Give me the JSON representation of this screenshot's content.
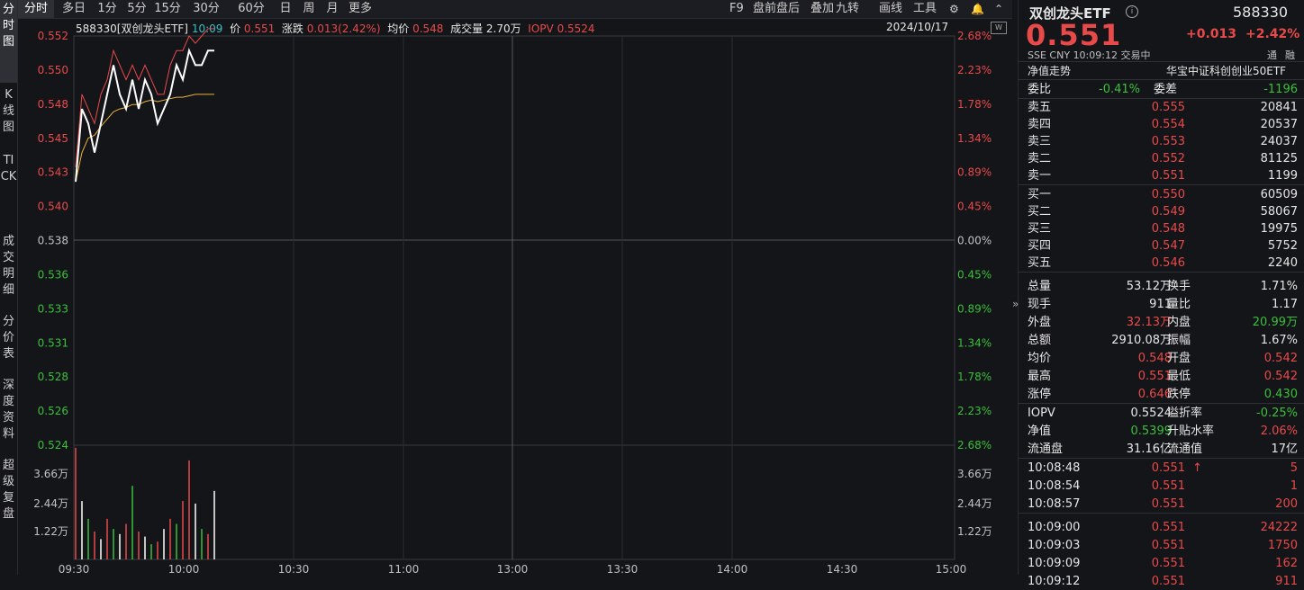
{
  "left_tabs": [
    "分时图",
    "K线图",
    "TICK",
    "成交明细",
    "分价表",
    "深度资料",
    "超级复盘"
  ],
  "toolbar": {
    "periods": [
      "分时",
      "多日",
      "1分",
      "5分",
      "15分",
      "30分",
      "60分",
      "日",
      "周",
      "月",
      "更多"
    ],
    "right": [
      "F9",
      "盘前盘后",
      "叠加",
      "九转",
      "画线",
      "工具"
    ],
    "gear_icon": "gear-icon",
    "bell_icon": "bell-icon",
    "up_icon": "chevron-up-icon"
  },
  "info": {
    "code_name": "588330[双创龙头ETF]",
    "time": "10:09",
    "price_label": "价",
    "price": "0.551",
    "change_label": "涨跌",
    "change": "0.013(2.42%)",
    "avg_label": "均价",
    "avg": "0.548",
    "vol_label": "成交量",
    "vol": "2.70万",
    "iopv_label": "IOPV",
    "iopv": "0.5524",
    "date": "2024/10/17"
  },
  "chart_data": {
    "type": "line",
    "price_axis": [
      "0.552",
      "0.550",
      "0.548",
      "0.545",
      "0.543",
      "0.540",
      "0.538",
      "0.536",
      "0.533",
      "0.531",
      "0.528",
      "0.526",
      "0.524"
    ],
    "pct_axis": [
      "2.68%",
      "2.23%",
      "1.78%",
      "1.34%",
      "0.89%",
      "0.45%",
      "0.00%",
      "0.45%",
      "0.89%",
      "1.34%",
      "1.78%",
      "2.23%",
      "2.68%"
    ],
    "vol_axis": [
      "3.66万",
      "2.44万",
      "1.22万"
    ],
    "time_axis": [
      "09:30",
      "10:00",
      "10:30",
      "11:00",
      "13:00",
      "13:30",
      "14:00",
      "14:30",
      "15:00"
    ],
    "ylim": [
      0.524,
      0.552
    ],
    "prev_close": 0.538,
    "vol_max": 4.5,
    "price": [
      0.542,
      0.547,
      0.546,
      0.544,
      0.546,
      0.548,
      0.55,
      0.548,
      0.547,
      0.549,
      0.547,
      0.549,
      0.548,
      0.546,
      0.547,
      0.548,
      0.55,
      0.549,
      0.551,
      0.55,
      0.55,
      0.551,
      0.551
    ],
    "avg": [
      0.542,
      0.544,
      0.545,
      0.5452,
      0.5458,
      0.5463,
      0.5468,
      0.547,
      0.5471,
      0.5473,
      0.5473,
      0.5475,
      0.5476,
      0.5475,
      0.5476,
      0.5477,
      0.5478,
      0.5478,
      0.5479,
      0.548,
      0.548,
      0.548,
      0.548
    ],
    "high_line": [
      0.543,
      0.548,
      0.547,
      0.546,
      0.548,
      0.549,
      0.551,
      0.55,
      0.549,
      0.55,
      0.549,
      0.55,
      0.549,
      0.548,
      0.548,
      0.55,
      0.551,
      0.551,
      0.552,
      0.5515,
      0.552,
      0.5525,
      0.5525
    ],
    "volume": [
      4.4,
      2.3,
      1.6,
      1.1,
      0.8,
      1.6,
      1.2,
      1.0,
      1.4,
      2.9,
      1.1,
      0.9,
      0.6,
      0.7,
      1.2,
      1.6,
      1.4,
      2.3,
      3.9,
      2.2,
      1.2,
      1.0,
      2.7
    ],
    "volume_color": [
      "r",
      "w",
      "g",
      "r",
      "w",
      "r",
      "g",
      "w",
      "r",
      "g",
      "r",
      "w",
      "g",
      "r",
      "w",
      "r",
      "g",
      "r",
      "r",
      "w",
      "g",
      "r",
      "w"
    ]
  },
  "panel": {
    "name": "双创龙头ETF",
    "code": "588330",
    "info_icon": "info-icon",
    "price": "0.551",
    "change": "+0.013",
    "change_pct": "+2.42%",
    "exchange": "SSE",
    "currency": "CNY",
    "time": "10:09:12",
    "status": "交易中",
    "tag1": "通",
    "tag2": "融",
    "nav_trend": "净值走势",
    "index_name": "华宝中证科创创业50ETF",
    "weibi_label": "委比",
    "weibi": "-0.41%",
    "weicha_label": "委差",
    "weicha": "-1196",
    "asks": [
      {
        "label": "卖五",
        "price": "0.555",
        "vol": "20841"
      },
      {
        "label": "卖四",
        "price": "0.554",
        "vol": "20537"
      },
      {
        "label": "卖三",
        "price": "0.553",
        "vol": "24037"
      },
      {
        "label": "卖二",
        "price": "0.552",
        "vol": "81125"
      },
      {
        "label": "卖一",
        "price": "0.551",
        "vol": "1199"
      }
    ],
    "bids": [
      {
        "label": "买一",
        "price": "0.550",
        "vol": "60509"
      },
      {
        "label": "买二",
        "price": "0.549",
        "vol": "58067"
      },
      {
        "label": "买三",
        "price": "0.548",
        "vol": "19975"
      },
      {
        "label": "买四",
        "price": "0.547",
        "vol": "5752"
      },
      {
        "label": "买五",
        "price": "0.546",
        "vol": "2240"
      }
    ],
    "stats": [
      {
        "l1": "总量",
        "v1": "53.12万",
        "c1": "white",
        "l2": "换手",
        "v2": "1.71%",
        "c2": "white"
      },
      {
        "l1": "现手",
        "v1": "911",
        "c1": "white",
        "l2": "量比",
        "v2": "1.17",
        "c2": "white"
      },
      {
        "l1": "外盘",
        "v1": "32.13万",
        "c1": "red",
        "l2": "内盘",
        "v2": "20.99万",
        "c2": "green"
      },
      {
        "l1": "总额",
        "v1": "2910.08万",
        "c1": "white",
        "l2": "振幅",
        "v2": "1.67%",
        "c2": "white"
      },
      {
        "l1": "均价",
        "v1": "0.548",
        "c1": "red",
        "l2": "开盘",
        "v2": "0.542",
        "c2": "red"
      },
      {
        "l1": "最高",
        "v1": "0.551",
        "c1": "red",
        "l2": "最低",
        "v2": "0.542",
        "c2": "red"
      },
      {
        "l1": "涨停",
        "v1": "0.646",
        "c1": "red",
        "l2": "跌停",
        "v2": "0.430",
        "c2": "green"
      }
    ],
    "stats2": [
      {
        "l1": "IOPV",
        "v1": "0.5524",
        "c1": "white",
        "l2": "溢折率",
        "v2": "-0.25%",
        "c2": "green"
      },
      {
        "l1": "净值",
        "v1": "0.5399",
        "c1": "green",
        "l2": "升贴水率",
        "v2": "2.06%",
        "c2": "red"
      },
      {
        "l1": "流通盘",
        "v1": "31.16亿",
        "c1": "white",
        "l2": "流通值",
        "v2": "17亿",
        "c2": "white"
      }
    ],
    "ticks": [
      {
        "t": "10:08:48",
        "p": "0.551",
        "v": "5",
        "arrow": "↑"
      },
      {
        "t": "10:08:54",
        "p": "0.551",
        "v": "1",
        "arrow": ""
      },
      {
        "t": "10:08:57",
        "p": "0.551",
        "v": "200",
        "arrow": ""
      },
      {
        "t": "10:09:00",
        "p": "0.551",
        "v": "24222",
        "arrow": ""
      },
      {
        "t": "10:09:03",
        "p": "0.551",
        "v": "1750",
        "arrow": ""
      },
      {
        "t": "10:09:09",
        "p": "0.551",
        "v": "162",
        "arrow": ""
      },
      {
        "t": "10:09:12",
        "p": "0.551",
        "v": "911",
        "arrow": ""
      }
    ],
    "expand_icon": "double-chevron-right-icon"
  }
}
